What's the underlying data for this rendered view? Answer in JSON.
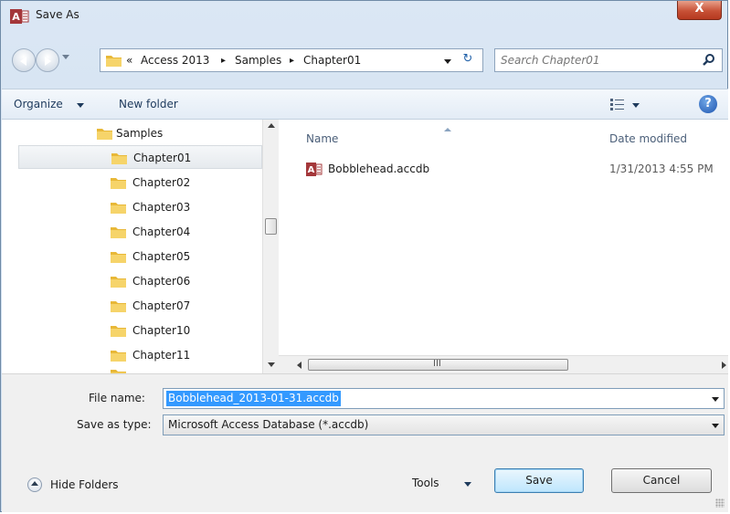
{
  "window": {
    "title": "Save As",
    "close_glyph": "X",
    "app_icon": "access-app-icon"
  },
  "navigation": {
    "breadcrumb_overflow": "«",
    "breadcrumbs": [
      "Access 2013",
      "Samples",
      "Chapter01"
    ],
    "separator": "▸",
    "refresh_glyph": "↻",
    "search_placeholder": "Search Chapter01"
  },
  "toolbar": {
    "organize_label": "Organize",
    "new_folder_label": "New folder",
    "help_glyph": "?"
  },
  "tree": {
    "items": [
      {
        "label": "Samples",
        "level": 0,
        "selected": false
      },
      {
        "label": "Chapter01",
        "level": 1,
        "selected": true
      },
      {
        "label": "Chapter02",
        "level": 1,
        "selected": false
      },
      {
        "label": "Chapter03",
        "level": 1,
        "selected": false
      },
      {
        "label": "Chapter04",
        "level": 1,
        "selected": false
      },
      {
        "label": "Chapter05",
        "level": 1,
        "selected": false
      },
      {
        "label": "Chapter06",
        "level": 1,
        "selected": false
      },
      {
        "label": "Chapter07",
        "level": 1,
        "selected": false
      },
      {
        "label": "Chapter10",
        "level": 1,
        "selected": false
      },
      {
        "label": "Chapter11",
        "level": 1,
        "selected": false
      }
    ]
  },
  "file_list": {
    "columns": {
      "name": "Name",
      "date_modified": "Date modified"
    },
    "files": [
      {
        "name": "Bobblehead.accdb",
        "date_modified": "1/31/2013 4:55 PM"
      }
    ],
    "hscroll_grip": "III"
  },
  "form": {
    "file_name_label": "File name:",
    "file_name_value": "Bobblehead_2013-01-31.accdb",
    "save_type_label": "Save as type:",
    "save_type_value": "Microsoft Access Database (*.accdb)"
  },
  "footer": {
    "hide_folders_label": "Hide Folders",
    "tools_label": "Tools",
    "save_label": "Save",
    "cancel_label": "Cancel"
  },
  "colors": {
    "selection": "#3399ff",
    "folder": "#e8b838",
    "close_button": "#c75136",
    "access_red": "#a4373a"
  }
}
